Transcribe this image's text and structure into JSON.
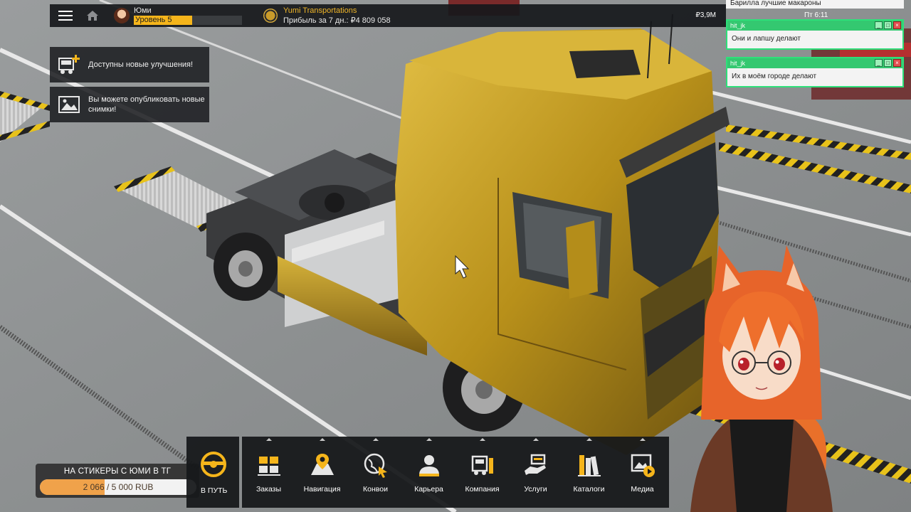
{
  "topbar": {
    "username": "Юми",
    "level": "Уровень 5",
    "company_name": "Yumi Transportations",
    "company_profit": "Прибыль за 7 дн.: ₽4 809 058",
    "money": "₽3,9M",
    "datetime": "Пт 6:11"
  },
  "notifications": [
    {
      "text": "Доступны новые улучшения!",
      "icon": "truck-upgrade-icon"
    },
    {
      "text": "Вы можете опубликовать новые снимки!",
      "icon": "photo-icon"
    }
  ],
  "chat": {
    "top_message": "Барилла лучшие макароны",
    "messages": [
      {
        "user": "hit_jk",
        "text": "Они и лапшу делают"
      },
      {
        "user": "hit_jk",
        "text": "Их в моём городе делают"
      }
    ]
  },
  "donation": {
    "title": "НА СТИКЕРЫ С ЮМИ В ТГ",
    "amount": "2 066 / 5 000 RUB",
    "progress": 0.4132
  },
  "toolbar": {
    "road_label": "В ПУТЬ",
    "items": [
      {
        "label": "Заказы",
        "icon": "orders-icon"
      },
      {
        "label": "Навигация",
        "icon": "navigation-map-icon"
      },
      {
        "label": "Конвои",
        "icon": "convoy-globe-icon"
      },
      {
        "label": "Карьера",
        "icon": "career-person-icon"
      },
      {
        "label": "Компания",
        "icon": "company-truck-icon"
      },
      {
        "label": "Услуги",
        "icon": "services-hand-icon"
      },
      {
        "label": "Каталоги",
        "icon": "catalogs-books-icon"
      },
      {
        "label": "Медиа",
        "icon": "media-play-icon"
      }
    ]
  },
  "colors": {
    "accent": "#f5b51b",
    "chat_border": "#2ee07a",
    "donation_fill": "#f0a24a",
    "truck": "#c9a21e"
  }
}
